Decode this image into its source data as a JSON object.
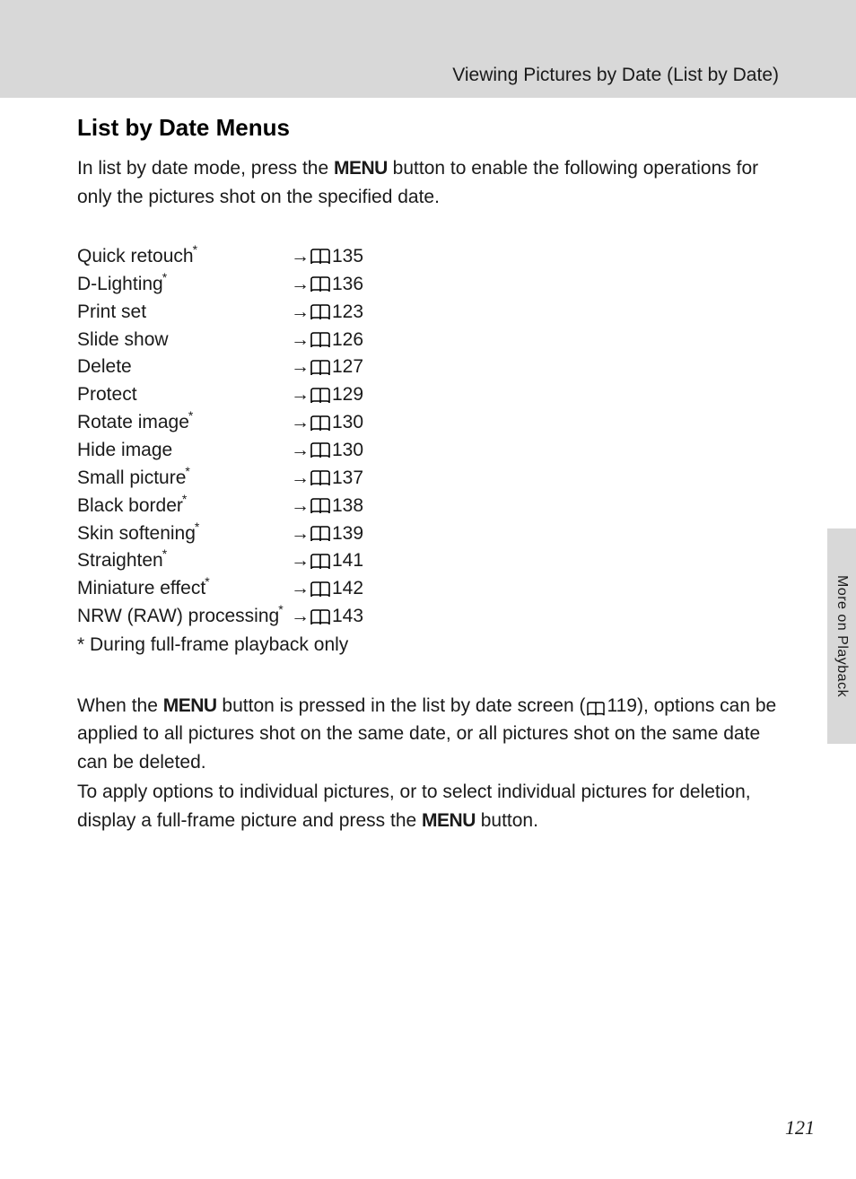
{
  "breadcrumb": "Viewing Pictures by Date (List by Date)",
  "section_title": "List by Date Menus",
  "intro": {
    "part1": "In list by date mode, press the ",
    "menu_word": "MENU",
    "part2": " button to enable the following operations for only the pictures shot on the specified date."
  },
  "options": [
    {
      "label": "Quick retouch",
      "star": true,
      "page": "135"
    },
    {
      "label": "D-Lighting",
      "star": true,
      "page": "136"
    },
    {
      "label": "Print set",
      "star": false,
      "page": "123"
    },
    {
      "label": "Slide show",
      "star": false,
      "page": "126"
    },
    {
      "label": "Delete",
      "star": false,
      "page": "127"
    },
    {
      "label": "Protect",
      "star": false,
      "page": "129"
    },
    {
      "label": "Rotate image",
      "star": true,
      "page": "130"
    },
    {
      "label": "Hide image",
      "star": false,
      "page": "130"
    },
    {
      "label": "Small picture",
      "star": true,
      "page": "137"
    },
    {
      "label": "Black border",
      "star": true,
      "page": "138"
    },
    {
      "label": "Skin softening",
      "star": true,
      "page": "139"
    },
    {
      "label": "Straighten",
      "star": true,
      "page": "141"
    },
    {
      "label": "Miniature effect",
      "star": true,
      "page": "142"
    },
    {
      "label": "NRW (RAW) processing",
      "star": true,
      "page": "143"
    }
  ],
  "footnote": "* During full-frame playback only",
  "para1": {
    "p1": "When the ",
    "menu_word": "MENU",
    "p2": " button is pressed in the list by date screen (",
    "ref": "119",
    "p3": "), options can be applied to all pictures shot on the same date, or all pictures shot on the same date can be deleted."
  },
  "para2": {
    "p1": "To apply options to individual pictures, or to select individual pictures for deletion, display a full-frame picture and press the ",
    "menu_word": "MENU",
    "p2": " button."
  },
  "side_tab": "More on Playback",
  "page_number": "121"
}
